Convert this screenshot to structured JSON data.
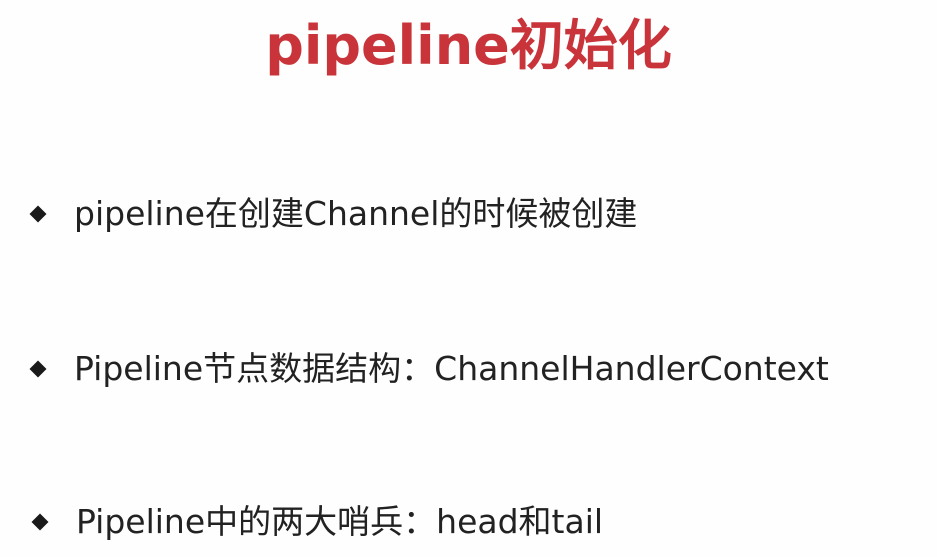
{
  "slide": {
    "title": "pipeline初始化",
    "title_color": "#c9343a",
    "bullet_icon": "diamond-icon",
    "bullets": [
      {
        "text": "pipeline在创建Channel的时候被创建"
      },
      {
        "text": "Pipeline节点数据结构：ChannelHandlerContext"
      },
      {
        "text": "Pipeline中的两大哨兵：head和tail"
      }
    ]
  }
}
